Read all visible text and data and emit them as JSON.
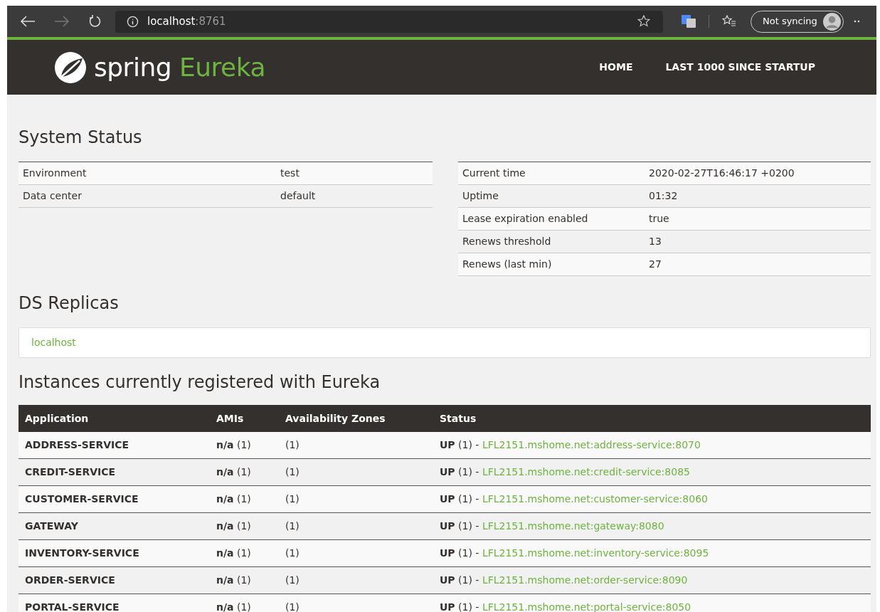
{
  "browser": {
    "url_host": "localhost",
    "url_port": ":8761",
    "sync_label": "Not syncing"
  },
  "navbar": {
    "brand_word": "spring",
    "brand_product": "Eureka",
    "links": [
      {
        "label": "HOME"
      },
      {
        "label": "LAST 1000 SINCE STARTUP"
      }
    ]
  },
  "system_status": {
    "title": "System Status",
    "left_rows": [
      {
        "label": "Environment",
        "value": "test"
      },
      {
        "label": "Data center",
        "value": "default"
      }
    ],
    "right_rows": [
      {
        "label": "Current time",
        "value": "2020-02-27T16:46:17 +0200"
      },
      {
        "label": "Uptime",
        "value": "01:32"
      },
      {
        "label": "Lease expiration enabled",
        "value": "true"
      },
      {
        "label": "Renews threshold",
        "value": "13"
      },
      {
        "label": "Renews (last min)",
        "value": "27"
      }
    ]
  },
  "ds_replicas": {
    "title": "DS Replicas",
    "items": [
      "localhost"
    ]
  },
  "instances": {
    "title": "Instances currently registered with Eureka",
    "columns": [
      "Application",
      "AMIs",
      "Availability Zones",
      "Status"
    ],
    "rows": [
      {
        "application": "ADDRESS-SERVICE",
        "amis": "**n/a** (1)",
        "zones": "(1)",
        "status": "**UP** (1) -",
        "link": "LFL2151.mshome.net:address-service:8070"
      },
      {
        "application": "CREDIT-SERVICE",
        "amis": "**n/a** (1)",
        "zones": "(1)",
        "status": "**UP** (1) -",
        "link": "LFL2151.mshome.net:credit-service:8085"
      },
      {
        "application": "CUSTOMER-SERVICE",
        "amis": "**n/a** (1)",
        "zones": "(1)",
        "status": "**UP** (1) -",
        "link": "LFL2151.mshome.net:customer-service:8060"
      },
      {
        "application": "GATEWAY",
        "amis": "**n/a** (1)",
        "zones": "(1)",
        "status": "**UP** (1) -",
        "link": "LFL2151.mshome.net:gateway:8080"
      },
      {
        "application": "INVENTORY-SERVICE",
        "amis": "**n/a** (1)",
        "zones": "(1)",
        "status": "**UP** (1) -",
        "link": "LFL2151.mshome.net:inventory-service:8095"
      },
      {
        "application": "ORDER-SERVICE",
        "amis": "**n/a** (1)",
        "zones": "(1)",
        "status": "**UP** (1) -",
        "link": "LFL2151.mshome.net:order-service:8090"
      },
      {
        "application": "PORTAL-SERVICE",
        "amis": "**n/a** (1)",
        "zones": "(1)",
        "status": "**UP** (1) -",
        "link": "LFL2151.mshome.net:portal-service:8050"
      }
    ]
  }
}
